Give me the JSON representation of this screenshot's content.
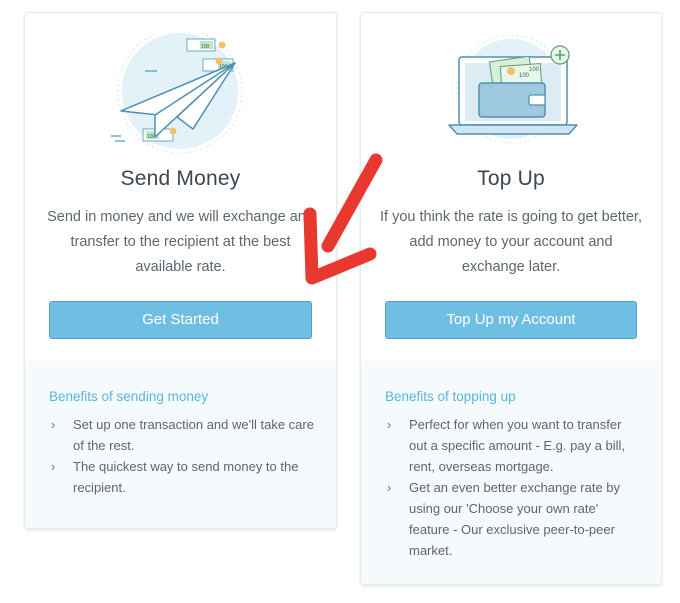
{
  "cards": [
    {
      "title": "Send Money",
      "description": "Send in money and we will exchange and transfer to the recipient at the best available rate.",
      "button_label": "Get Started",
      "benefits_title": "Benefits of sending money",
      "benefits": [
        "Set up one transaction and we'll take care of the rest.",
        "The quickest way to send money to the recipient."
      ],
      "illustration_icon": "paper-plane-money-illustration",
      "banknote_label": "100"
    },
    {
      "title": "Top Up",
      "description": "If you think the rate is going to get better, add money to your account and exchange later.",
      "button_label": "Top Up my Account",
      "benefits_title": "Benefits of topping up",
      "benefits": [
        "Perfect for when you want to transfer out a specific amount - E.g. pay a bill, rent, overseas mortgage.",
        "Get an even better exchange rate by using our 'Choose your own rate' feature - Our exclusive peer-to-peer market."
      ],
      "illustration_icon": "laptop-wallet-illustration",
      "banknote_label": "100"
    }
  ],
  "annotation": {
    "icon": "red-arrow-annotation",
    "color": "#e8382f"
  },
  "colors": {
    "button": "#6fbfe3",
    "benefits_title": "#58b5de",
    "title": "#3b4750"
  }
}
